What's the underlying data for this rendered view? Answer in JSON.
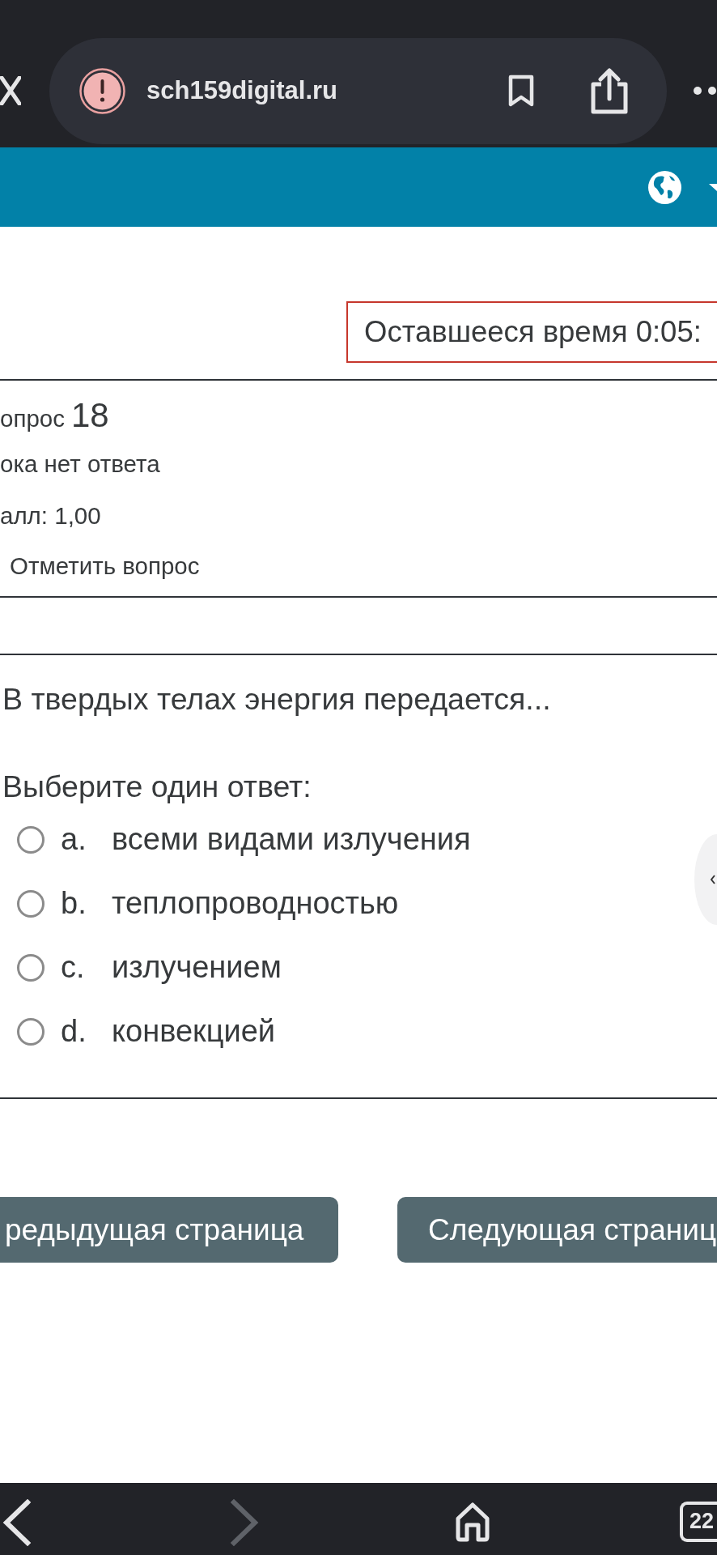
{
  "browser": {
    "url": "sch159digital.ru"
  },
  "timer": {
    "text": "Оставшееся время 0:05:"
  },
  "question_info": {
    "label": "опрос",
    "number": "18",
    "status": "ока нет ответа",
    "grade": "алл: 1,00",
    "flag_link": "Отметить вопрос"
  },
  "question": {
    "text": "В твердых телах энергия передается...",
    "prompt": "Выберите один ответ:",
    "options": [
      {
        "letter": "a.",
        "text": "всеми видами излучения",
        "selected": false
      },
      {
        "letter": "b.",
        "text": "теплопроводностью",
        "selected": false
      },
      {
        "letter": "c.",
        "text": "излучением",
        "selected": false
      },
      {
        "letter": "d.",
        "text": "конвекцией",
        "selected": false
      }
    ]
  },
  "navigation": [
    {
      "kind": "previous",
      "label": "редыдущая страница"
    },
    {
      "kind": "next",
      "label": "Следующая страниц"
    }
  ],
  "toolbar": {
    "forward_disabled": true,
    "tab_count": "22"
  }
}
